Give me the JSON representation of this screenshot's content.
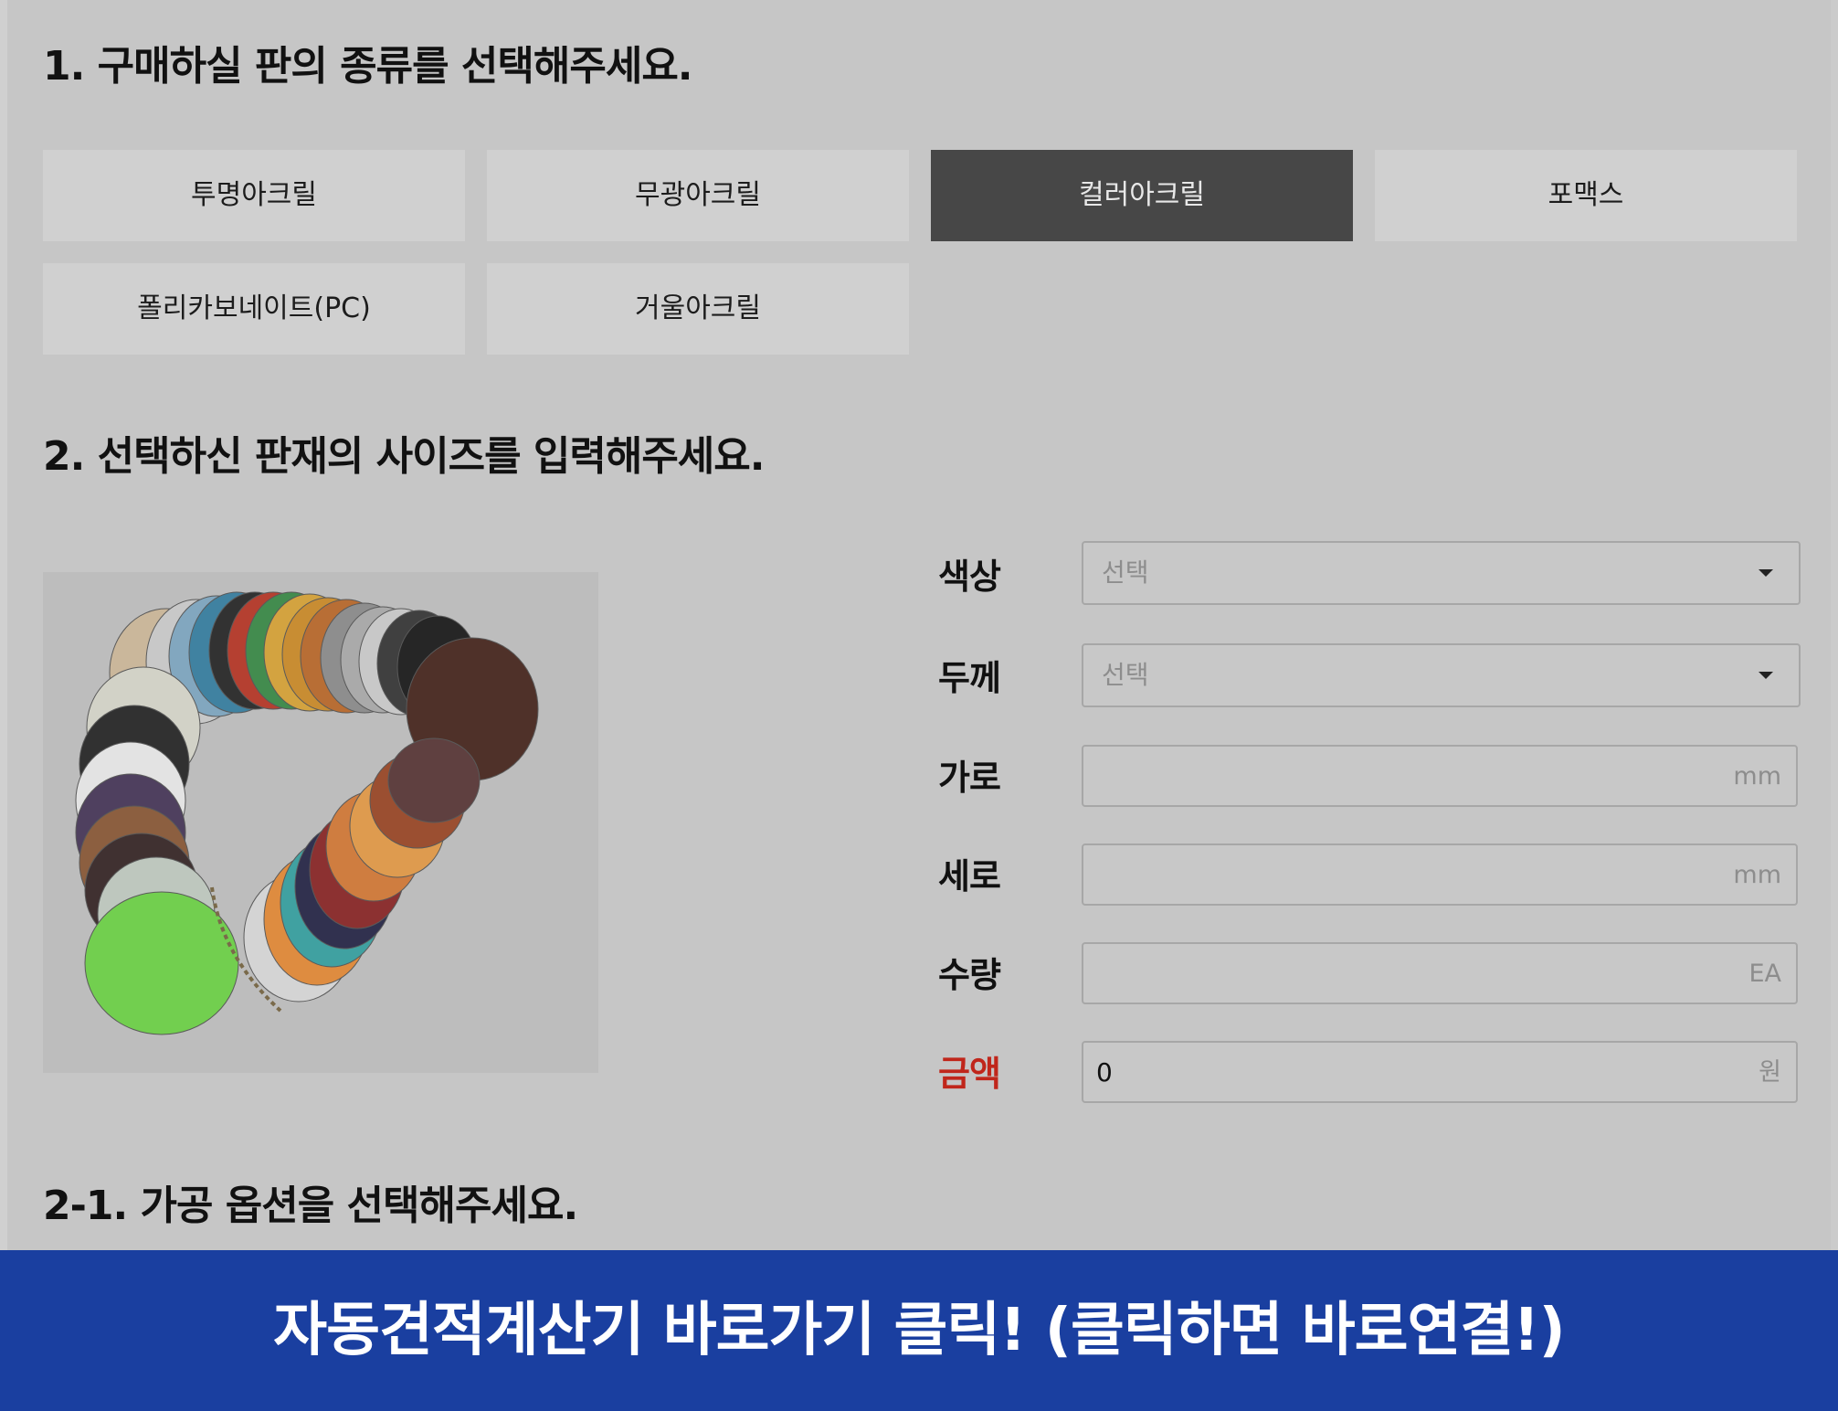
{
  "section1": {
    "heading": "1. 구매하실 판의 종류를 선택해주세요.",
    "tabs": [
      {
        "label": "투명아크릴",
        "active": false
      },
      {
        "label": "무광아크릴",
        "active": false
      },
      {
        "label": "컬러아크릴",
        "active": true
      },
      {
        "label": "포맥스",
        "active": false
      },
      {
        "label": "폴리카보네이트(PC)",
        "active": false
      },
      {
        "label": "거울아크릴",
        "active": false
      }
    ]
  },
  "section2": {
    "heading": "2. 선택하신 판재의 사이즈를 입력해주세요.",
    "form": {
      "color": {
        "label": "색상",
        "placeholder": "선택"
      },
      "thickness": {
        "label": "두께",
        "placeholder": "선택"
      },
      "width": {
        "label": "가로",
        "value": "",
        "unit": "mm"
      },
      "height": {
        "label": "세로",
        "value": "",
        "unit": "mm"
      },
      "quantity": {
        "label": "수량",
        "value": "",
        "unit": "EA"
      },
      "price": {
        "label": "금액",
        "value": "0",
        "unit": "원"
      }
    }
  },
  "section3": {
    "heading": "2-1. 가공 옵션을 선택해주세요."
  },
  "banner": {
    "text": "자동견적계산기 바로가기 클릭! (클릭하면 바로연결!)"
  },
  "colors": {
    "background": "#c6c6c6",
    "tab": "#d0d0d0",
    "tab_active": "#474747",
    "price_label": "#c0261b",
    "banner": "#1a3fa0"
  }
}
